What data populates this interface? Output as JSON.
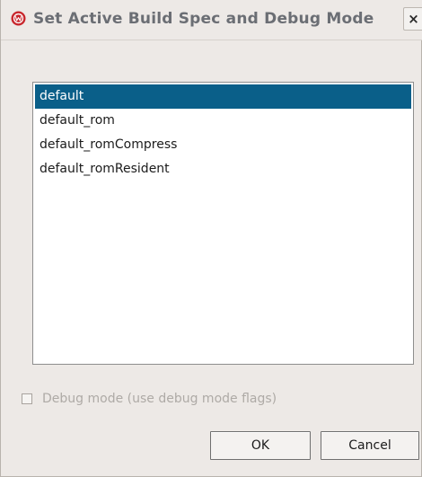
{
  "window": {
    "title": "Set Active Build Spec and Debug Mode",
    "close_label": "×",
    "app_icon": "wind-river-logo-icon"
  },
  "build_specs": {
    "items": [
      {
        "label": "default",
        "selected": true
      },
      {
        "label": "default_rom",
        "selected": false
      },
      {
        "label": "default_romCompress",
        "selected": false
      },
      {
        "label": "default_romResident",
        "selected": false
      }
    ]
  },
  "debug_mode": {
    "label": "Debug mode (use debug mode flags)",
    "checked": false,
    "enabled": false
  },
  "buttons": {
    "ok_label": "OK",
    "cancel_label": "Cancel"
  },
  "colors": {
    "selection": "#0a5f89",
    "background": "#ede9e6",
    "icon_red": "#c8262c"
  }
}
